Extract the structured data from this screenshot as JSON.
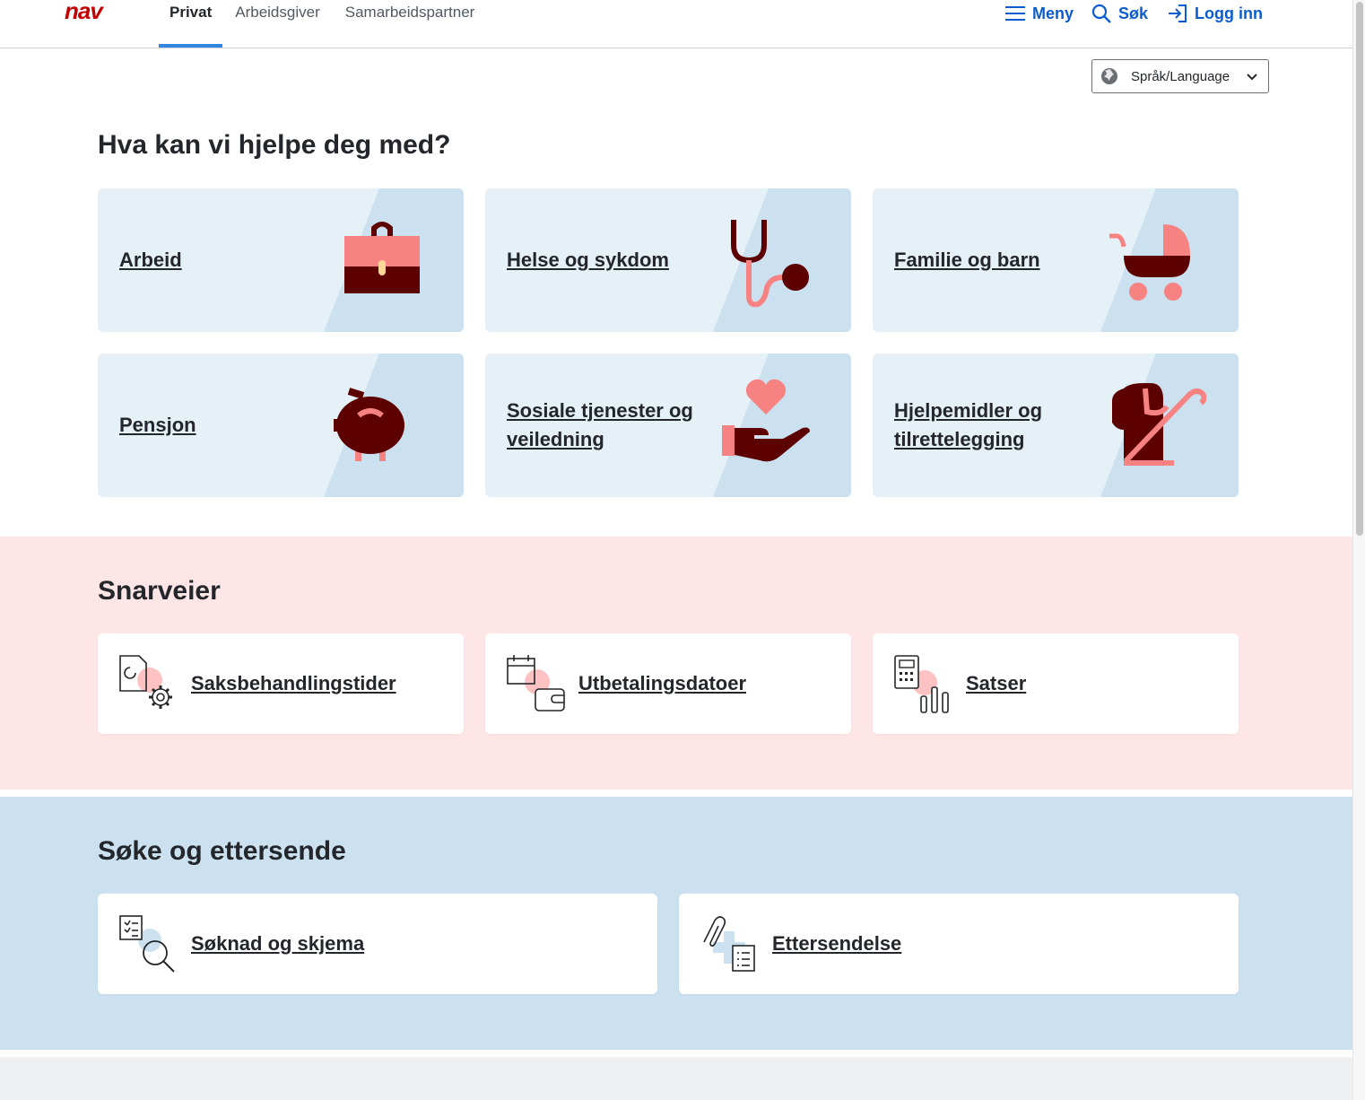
{
  "header": {
    "logo_text": "nav",
    "tabs": [
      {
        "label": "Privat",
        "active": true
      },
      {
        "label": "Arbeidsgiver",
        "active": false
      },
      {
        "label": "Samarbeidspartner",
        "active": false
      }
    ],
    "menu_label": "Meny",
    "search_label": "Søk",
    "login_label": "Logg inn"
  },
  "language": {
    "label": "Språk/Language"
  },
  "help": {
    "heading": "Hva kan vi hjelpe deg med?",
    "cards": [
      {
        "label": "Arbeid",
        "icon": "briefcase-icon"
      },
      {
        "label": "Helse og sykdom",
        "icon": "stethoscope-icon"
      },
      {
        "label": "Familie og barn",
        "icon": "stroller-icon"
      },
      {
        "label": "Pensjon",
        "icon": "piggy-bank-icon"
      },
      {
        "label": "Sosiale tjenester og veiledning",
        "icon": "heart-hand-icon"
      },
      {
        "label": "Hjelpemidler og tilrettelegging",
        "icon": "guide-dog-icon"
      }
    ]
  },
  "shortcuts": {
    "heading": "Snarveier",
    "items": [
      {
        "label": "Saksbehandlingstider",
        "icon": "document-gear-icon"
      },
      {
        "label": "Utbetalingsdatoer",
        "icon": "calendar-wallet-icon"
      },
      {
        "label": "Satser",
        "icon": "calculator-chart-icon"
      }
    ]
  },
  "apply": {
    "heading": "Søke og ettersende",
    "items": [
      {
        "label": "Søknad og skjema",
        "icon": "form-search-icon"
      },
      {
        "label": "Ettersendelse",
        "icon": "paperclip-plus-icon"
      }
    ]
  },
  "colors": {
    "brand_red": "#c30000",
    "link_blue": "#0b5cd0",
    "card_bg": "#e6f0f7",
    "card_diag": "#cce1f0",
    "shortcut_bg": "#ffe6e6",
    "apply_bg": "#cce1f0",
    "illustration_dark": "#5c0000",
    "illustration_light": "#f68282"
  }
}
